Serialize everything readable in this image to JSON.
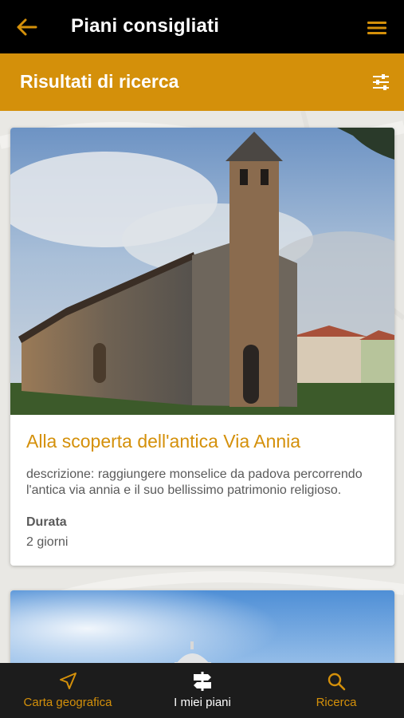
{
  "header": {
    "title": "Piani consigliati",
    "back_icon": "arrow-left-icon",
    "menu_icon": "hamburger-menu-icon"
  },
  "subheader": {
    "title": "Risultati di ricerca",
    "filter_icon": "sliders-filter-icon"
  },
  "results": [
    {
      "title": "Alla scoperta dell'antica Via Annia",
      "description": "descrizione: raggiungere monselice da padova percorrendo l'antica via annia e il suo bellissimo patrimonio religioso.",
      "duration_label": "Durata",
      "duration_value": "2 giorni",
      "image": "church-with-bell-tower-photo"
    },
    {
      "image": "sky-with-building-dome-photo"
    }
  ],
  "bottom_nav": {
    "items": [
      {
        "label": "Carta geografica",
        "icon": "navigation-arrow-icon",
        "active": false
      },
      {
        "label": "I miei piani",
        "icon": "signpost-icon",
        "active": true
      },
      {
        "label": "Ricerca",
        "icon": "search-icon",
        "active": false
      }
    ]
  },
  "colors": {
    "accent": "#d4900a",
    "header_bg": "#000000",
    "bottom_bar_bg": "#1c1c1c",
    "background": "#ebeae6",
    "text_gray": "#5a5a5a"
  }
}
